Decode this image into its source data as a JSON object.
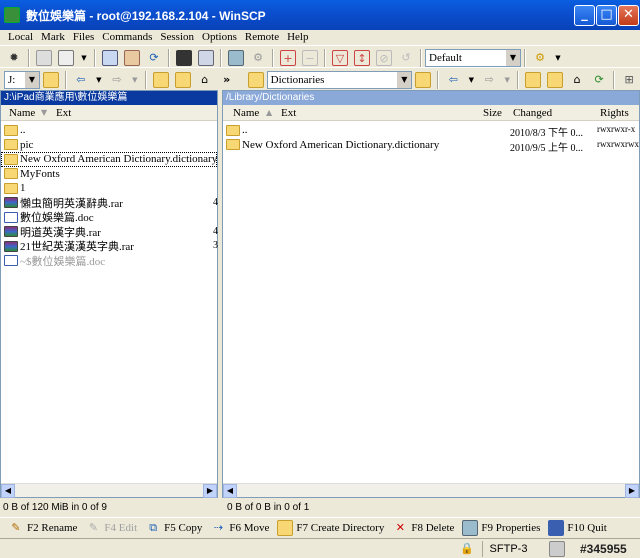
{
  "window": {
    "title": "數位娛樂篇 - root@192.168.2.104 - WinSCP",
    "minimize": "_",
    "maximize": "□",
    "close": "✕"
  },
  "menu": [
    "Local",
    "Mark",
    "Files",
    "Commands",
    "Session",
    "Options",
    "Remote",
    "Help"
  ],
  "toolbar": {
    "transfer_settings": "Default"
  },
  "left_panel": {
    "drive": "J:",
    "path": "J:\\iPad商業應用\\數位娛樂篇",
    "columns": {
      "name": "Name",
      "ext": "Ext"
    },
    "files": [
      {
        "name": "..",
        "type": "updir",
        "extra": ""
      },
      {
        "name": "pic",
        "type": "folder",
        "extra": ""
      },
      {
        "name": "New Oxford American Dictionary.dictionary",
        "type": "folder",
        "extra": ""
      },
      {
        "name": "MyFonts",
        "type": "folder",
        "extra": ""
      },
      {
        "name": "1",
        "type": "folder",
        "extra": ""
      },
      {
        "name": "懶虫簡明英漢辭典.rar",
        "type": "rar",
        "extra": "4"
      },
      {
        "name": "數位娛樂篇.doc",
        "type": "doc",
        "extra": ""
      },
      {
        "name": "明道英漢字典.rar",
        "type": "rar",
        "extra": "4"
      },
      {
        "name": "21世紀英漢漢英字典.rar",
        "type": "rar",
        "extra": "3"
      },
      {
        "name": "~$數位娛樂篇.doc",
        "type": "doc-hidden",
        "extra": ""
      }
    ],
    "status": "0 B of 120 MiB in 0 of 9"
  },
  "right_panel": {
    "folder": "Dictionaries",
    "path": "/Library/Dictionaries",
    "columns": {
      "name": "Name",
      "ext": "Ext",
      "size": "Size",
      "changed": "Changed",
      "rights": "Rights"
    },
    "files": [
      {
        "name": "..",
        "type": "updir",
        "changed": "2010/8/3 下午 0...",
        "rights": "rwxrwxr-x"
      },
      {
        "name": "New Oxford American Dictionary.dictionary",
        "type": "folder",
        "changed": "2010/9/5 上午 0...",
        "rights": "rwxrwxrwx"
      }
    ],
    "status": "0 B of 0 B in 0 of 1"
  },
  "function_keys": [
    {
      "label": "F2 Rename",
      "icon": "rename-icon",
      "enabled": true
    },
    {
      "label": "F4 Edit",
      "icon": "edit-icon",
      "enabled": false
    },
    {
      "label": "F5 Copy",
      "icon": "copy-icon",
      "enabled": true
    },
    {
      "label": "F6 Move",
      "icon": "move-icon",
      "enabled": true
    },
    {
      "label": "F7 Create Directory",
      "icon": "create-directory-icon",
      "enabled": true
    },
    {
      "label": "F8 Delete",
      "icon": "delete-icon",
      "enabled": true
    },
    {
      "label": "F9 Properties",
      "icon": "properties-icon",
      "enabled": true
    },
    {
      "label": "F10 Quit",
      "icon": "quit-icon",
      "enabled": true
    }
  ],
  "statusbar": {
    "protocol": "SFTP-3",
    "watermark": "#345955"
  },
  "colors": {
    "titlebar": "#0b4fd0",
    "left_path_bg": "#0a3a9f",
    "right_path_bg": "#8aa8d8",
    "background": "#ece9d8"
  }
}
